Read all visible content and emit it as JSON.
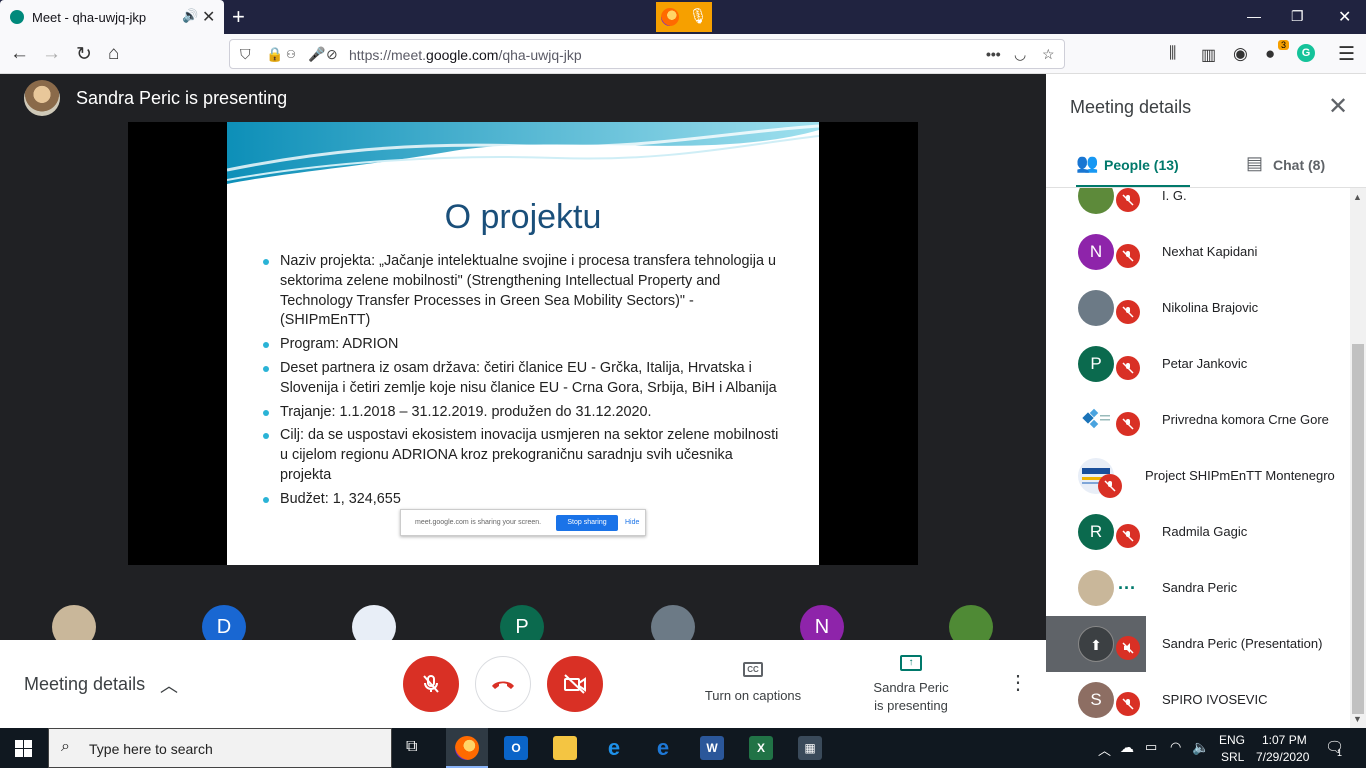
{
  "browser": {
    "tab_title": "Meet - qha-uwjq-jkp",
    "url_prefix": "https://meet.",
    "url_domain": "google.com",
    "url_path": "/qha-uwjq-jkp",
    "badge_count": "3"
  },
  "stage": {
    "presenting_text": "Sandra Peric is presenting"
  },
  "slide": {
    "title": "O projektu",
    "bullets": [
      "Naziv projekta: „Jačanje intelektualne svojine i procesa transfera tehnologija u sektorima zelene mobilnosti\" (Strengthening Intellectual Property and Technology Transfer Processes in Green Sea Mobility Sectors)\" - (SHIPmEnTT)",
      "Program: ADRION",
      "Deset partnera iz osam država: četiri članice EU - Grčka, Italija, Hrvatska i Slovenija i četiri zemlje koje nisu članice EU - Crna Gora, Srbija, BiH i Albanija",
      "Trajanje: 1.1.2018 – 31.12.2019. produžen do 31.12.2020.",
      "Cilj: da se uspostavi ekosistem inovacija usmjeren na sektor zelene mobilnosti u cijelom regionu ADRIONA kroz prekograničnu saradnju svih učesnika projekta",
      "Budžet: 1, 324,655"
    ],
    "sharebar": {
      "message": "meet.google.com is sharing your screen.",
      "stop": "Stop sharing",
      "hide": "Hide"
    }
  },
  "filmstrip": [
    {
      "initial": "",
      "color": "#c9b79a"
    },
    {
      "initial": "D",
      "color": "#1967d2"
    },
    {
      "initial": "",
      "color": "#e8eef7"
    },
    {
      "initial": "P",
      "color": "#0b6a4e"
    },
    {
      "initial": "",
      "color": "#6c7a86"
    },
    {
      "initial": "N",
      "color": "#8e24aa"
    },
    {
      "initial": "",
      "color": "#4f8a35"
    }
  ],
  "bottombar": {
    "meeting_details": "Meeting details",
    "captions": "Turn on captions",
    "presenting_line1": "Sandra Peric",
    "presenting_line2": "is presenting"
  },
  "panel": {
    "title": "Meeting details",
    "tab_people": "People (13)",
    "tab_chat": "Chat (8)",
    "people": [
      {
        "name": "I. G.",
        "initial": "",
        "color": "#5d8a3a"
      },
      {
        "name": "Nexhat Kapidani",
        "initial": "N",
        "color": "#8e24aa"
      },
      {
        "name": "Nikolina Brajovic",
        "initial": "",
        "color": "#6c7a86"
      },
      {
        "name": "Petar Jankovic",
        "initial": "P",
        "color": "#0b6a4e"
      },
      {
        "name": "Privredna komora Crne Gore",
        "initial": "",
        "color": "#ffffff"
      },
      {
        "name": "Project SHIPmEnTT Montenegro",
        "initial": "",
        "color": "#e8eef7"
      },
      {
        "name": "Radmila Gagic",
        "initial": "R",
        "color": "#0b6a4e"
      },
      {
        "name": "Sandra Peric",
        "initial": "",
        "color": "#c9b79a"
      },
      {
        "name": "Sandra Peric (Presentation)",
        "initial": "",
        "color": "#5f6368"
      },
      {
        "name": "SPIRO IVOSEVIC",
        "initial": "S",
        "color": "#8d6e63"
      }
    ]
  },
  "taskbar": {
    "search_placeholder": "Type here to search",
    "lang1": "ENG",
    "lang2": "SRL",
    "time": "1:07 PM",
    "date": "7/29/2020",
    "notif_count": "1"
  }
}
